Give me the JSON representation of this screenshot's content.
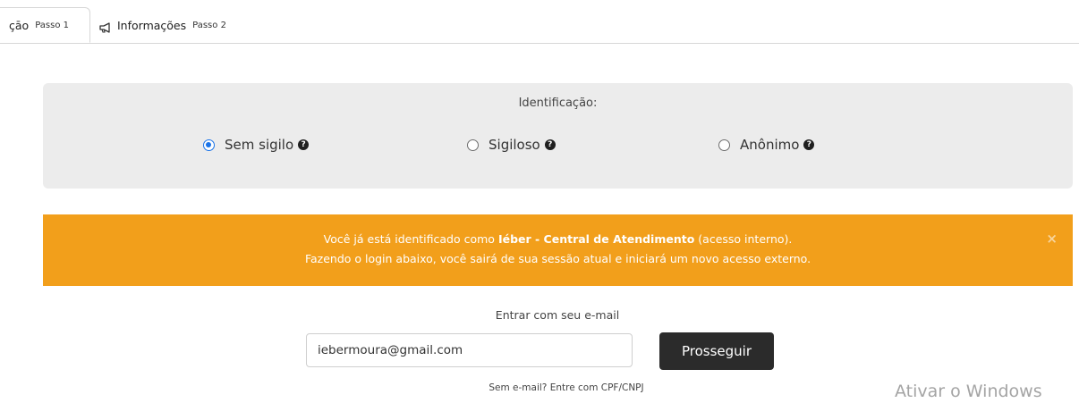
{
  "tabs": [
    {
      "title": "çāo",
      "step": "Passo 1"
    },
    {
      "title": "Informações",
      "step": "Passo 2",
      "icon": "megaphone-icon"
    }
  ],
  "identification": {
    "label": "Identificação:",
    "options": [
      {
        "label": "Sem sigilo",
        "checked": true,
        "help_icon": "question-circle-icon"
      },
      {
        "label": "Sigiloso",
        "checked": false,
        "help_icon": "question-circle-icon"
      },
      {
        "label": "Anônimo",
        "checked": false,
        "help_icon": "question-circle-icon"
      }
    ]
  },
  "alert": {
    "line1_prefix": "Você já está identificado como ",
    "line1_name": "Iéber - Central de Atendimento",
    "line1_suffix": " (acesso interno).",
    "line2": "Fazendo o login abaixo, você sairá de sua sessão atual e iniciará um novo acesso externo.",
    "close": "×",
    "color": "#f29f1b"
  },
  "login": {
    "label": "Entrar com seu e-mail",
    "email_value": "iebermoura@gmail.com",
    "submit_label": "Prosseguir",
    "alt_link": "Sem e-mail? Entre com CPF/CNPJ"
  },
  "watermark": "Ativar o Windows"
}
